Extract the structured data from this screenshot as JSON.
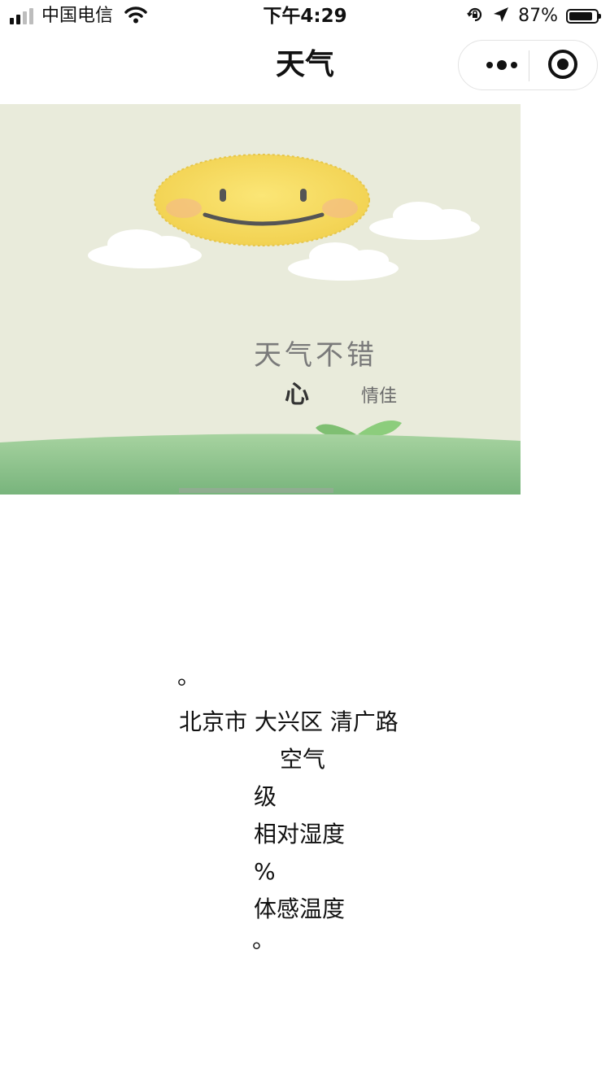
{
  "status_bar": {
    "carrier": "中国电信",
    "time": "下午4:29",
    "battery_percent": "87%",
    "battery_level": 0.87,
    "icons": [
      "signal-icon",
      "wifi-icon",
      "rotation-lock-icon",
      "location-arrow-icon",
      "battery-icon"
    ]
  },
  "nav": {
    "title": "天气",
    "capsule_icons": [
      "more-dots-icon",
      "close-target-icon"
    ]
  },
  "banner": {
    "headline": "天气不错",
    "tagline_big": "心",
    "tagline_small": "情佳",
    "colors": {
      "sky": "#e9ebdb",
      "sun": "#f5dc60",
      "grass": "#86c186"
    }
  },
  "weather": {
    "dot_top": "。",
    "address": "北京市 大兴区 清广路",
    "air_label": "空气",
    "level_label": "级",
    "humidity_label": "相对湿度",
    "humidity_unit": "%",
    "feels_like_label": "体感温度",
    "dot_bottom": "。"
  }
}
